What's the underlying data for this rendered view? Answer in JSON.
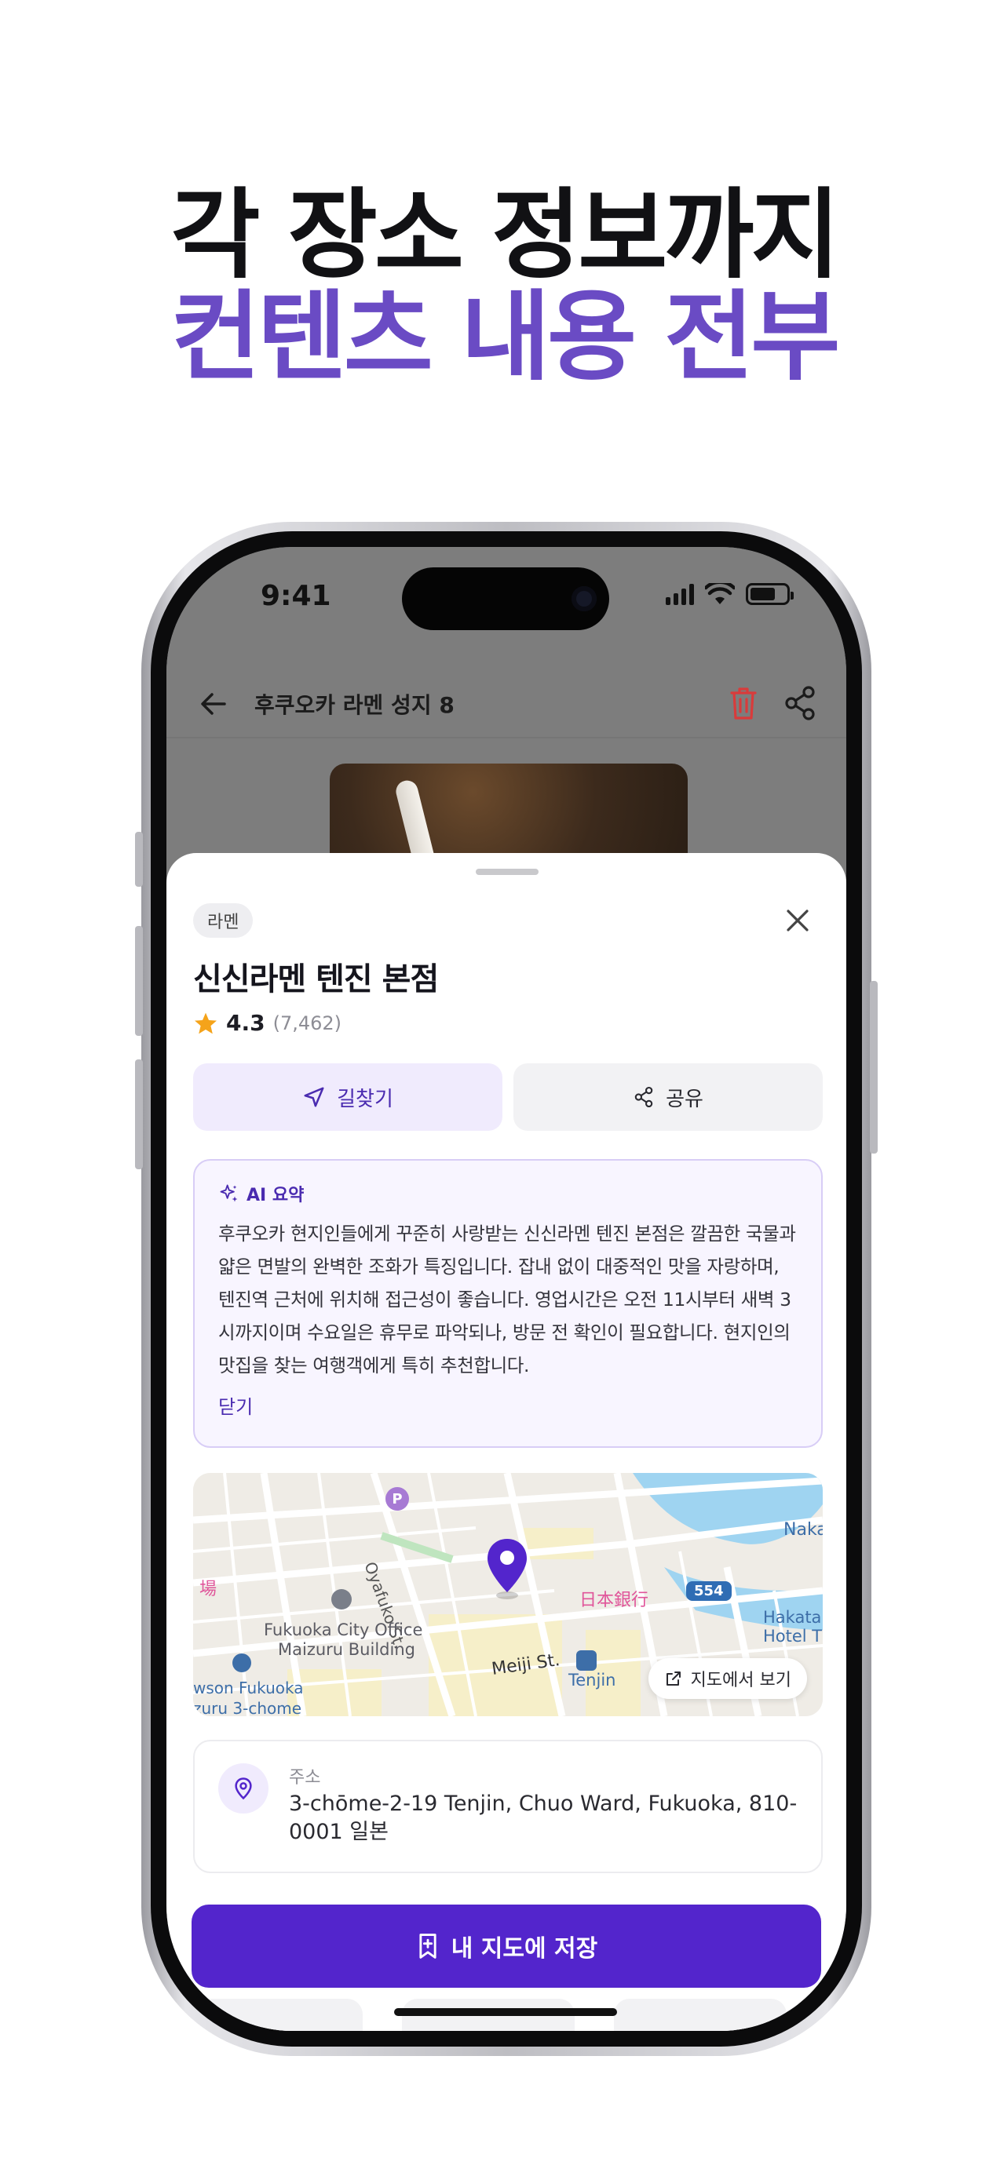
{
  "headline": {
    "line1": "각 장소 정보까지",
    "line2": "컨텐츠 내용 전부"
  },
  "status_bar": {
    "time": "9:41",
    "icons": [
      "signal-icon",
      "wifi-icon",
      "battery-icon"
    ]
  },
  "app_bar": {
    "title": "후쿠오카 라멘 성지 8",
    "icons": [
      "back-arrow-icon",
      "trash-icon",
      "share-icon"
    ]
  },
  "sheet": {
    "tag": "라멘",
    "title": "신신라멘 텐진 본점",
    "rating": {
      "score": "4.3",
      "count": "(7,462)"
    },
    "actions": {
      "directions": "길찾기",
      "share": "공유"
    },
    "ai_summary": {
      "label": "AI 요약",
      "text": "후쿠오카 현지인들에게 꾸준히 사랑받는 신신라멘 텐진 본점은 깔끔한 국물과 얇은 면발의 완벽한 조화가 특징입니다. 잡내 없이 대중적인 맛을 자랑하며, 텐진역 근처에 위치해 접근성이 좋습니다. 영업시간은 오전 11시부터 새벽 3시까지이며 수요일은 휴무로 파악되나, 방문 전 확인이 필요합니다. 현지인의 맛집을 찾는 여행객에게 특히 추천합니다.",
      "close": "닫기"
    },
    "map": {
      "labels": {
        "oyafuko": "Oyafuko St.",
        "fukuoka_city_office": "Fukuoka City Office",
        "maizuru": "Maizuru Building",
        "meiji": "Meiji St.",
        "tenjin": "Tenjin",
        "boj": "日本銀行",
        "route": "554",
        "naka": "Naka",
        "hakata": "Hakata",
        "hotel": "Hotel T",
        "lawson": "wson Fukuoka",
        "zuru": "zuru 3-chome",
        "jo": "場",
        "parking": "P"
      },
      "open_button": "지도에서 보기"
    },
    "address": {
      "label": "주소",
      "value": "3-chōme-2-19 Tenjin, Chuo Ward, Fukuoka, 810-0001 일본"
    },
    "save_button": "내 지도에 저장"
  },
  "colors": {
    "accent": "#5325cc",
    "headline_accent": "#6a4bc4",
    "trash": "#d93b3b",
    "star": "#f5a31a"
  }
}
